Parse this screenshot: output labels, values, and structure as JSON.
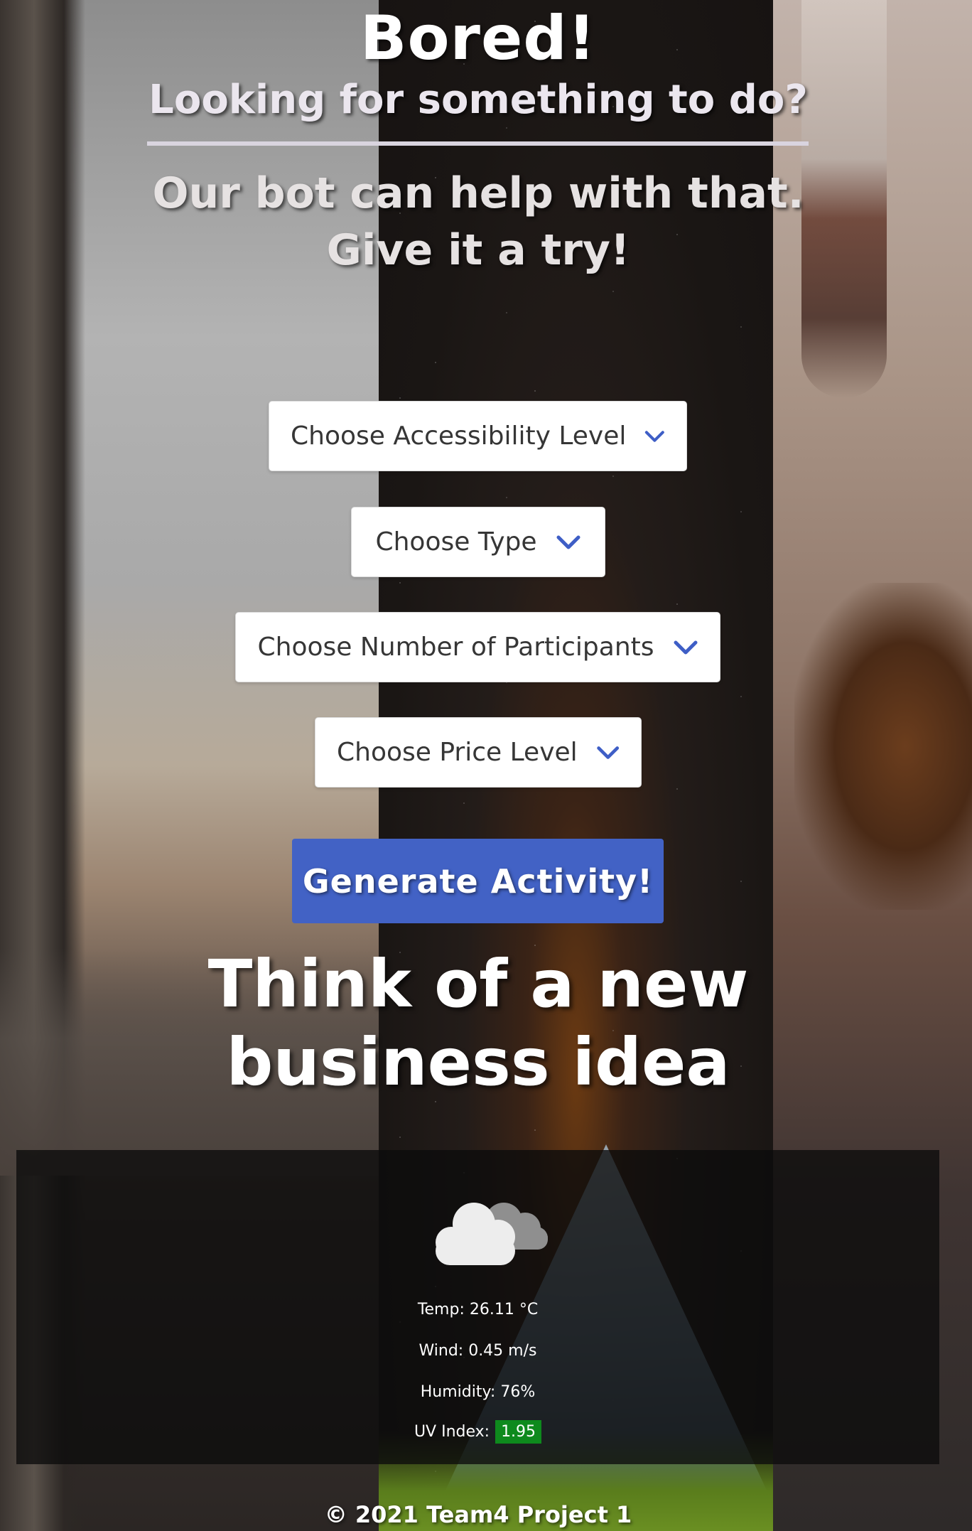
{
  "header": {
    "title": "Bored!",
    "subtitle": "Looking for something to do?",
    "tagline_line1": "Our bot can help with that.",
    "tagline_line2": "Give it a try!"
  },
  "filters": {
    "accessibility": {
      "label": "Choose Accessibility Level",
      "icon": "chevron-down-icon"
    },
    "type": {
      "label": "Choose Type",
      "icon": "chevron-down-icon"
    },
    "participants": {
      "label": "Choose Number of Participants",
      "icon": "chevron-down-icon"
    },
    "price": {
      "label": "Choose Price Level",
      "icon": "chevron-down-icon"
    }
  },
  "generate_button": {
    "label": "Generate Activity!"
  },
  "activity": {
    "text": "Think of a new business idea"
  },
  "weather": {
    "icon": "cloudy-icon",
    "temp": "Temp: 26.11 °C",
    "wind": "Wind: 0.45 m/s",
    "humidity": "Humidity: 76%",
    "uv_label": "UV Index:",
    "uv_value": "1.95"
  },
  "footer": {
    "text": "© 2021 Team4 Project 1"
  },
  "colors": {
    "button": "#4262c5",
    "chevron": "#3e5ec6",
    "uv_badge": "#0e8a1d",
    "weather_panel": "#0c0c0c"
  }
}
